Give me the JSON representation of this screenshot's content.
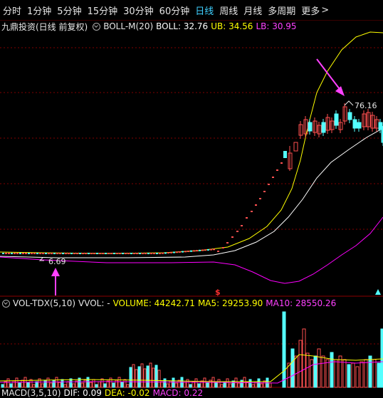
{
  "tabs": [
    {
      "label": "分时",
      "active": false
    },
    {
      "label": "1分钟",
      "active": false
    },
    {
      "label": "5分钟",
      "active": false
    },
    {
      "label": "15分钟",
      "active": false
    },
    {
      "label": "30分钟",
      "active": false
    },
    {
      "label": "60分钟",
      "active": false
    },
    {
      "label": "日线",
      "active": true
    },
    {
      "label": "周线",
      "active": false
    },
    {
      "label": "月线",
      "active": false
    },
    {
      "label": "多周期",
      "active": false
    },
    {
      "label": "更多",
      "active": false
    }
  ],
  "main_header": {
    "stock": "九鼎投资(日线 前复权)",
    "indicator": "BOLL-M(20)",
    "boll": "BOLL: 32.76",
    "ub": "UB: 34.56",
    "lb": "LB: 30.95"
  },
  "price_labels": {
    "high": "76.16",
    "low": "6.69"
  },
  "volume_header": {
    "indicator": "VOL-TDX(5,10)",
    "vvol": "VVOL: -",
    "volume": "VOLUME: 44242.71",
    "ma5": "MA5: 29253.90",
    "ma10": "MA10: 28550.26"
  },
  "macd_header": {
    "indicator": "MACD(3,5,10)",
    "dif": "DIF: 0.09",
    "dea": "DEA: -0.02",
    "macd": "MACD: 0.22"
  },
  "colors": {
    "up": "#ff5050",
    "down": "#54ffff",
    "boll": "#ffffff",
    "ub": "#ffff00",
    "lb": "#ff00ff",
    "grid": "#800000",
    "active_tab": "#3fd0ff",
    "arrow": "#ff40ff"
  },
  "icons": {
    "more": "chevron-right-icon",
    "indicator_toggle": "circle-chevron-icon",
    "dollar": "dollar-marker-icon"
  }
}
